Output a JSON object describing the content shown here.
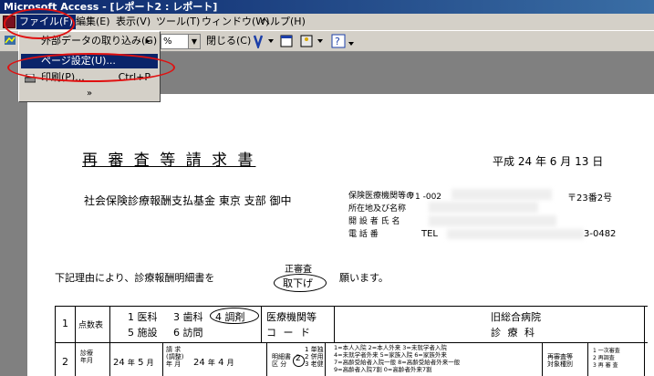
{
  "window": {
    "title": "Microsoft Access - [レポート2 : レポート]"
  },
  "menu": {
    "items": [
      {
        "label": "ファイル(F)"
      },
      {
        "label": "編集(E)"
      },
      {
        "label": "表示(V)"
      },
      {
        "label": "ツール(T)"
      },
      {
        "label": "ウィンドウ(W)"
      },
      {
        "label": "ヘルプ(H)"
      }
    ]
  },
  "toolbar": {
    "external_data": "外部データの取り込み(G)",
    "zoom": "%",
    "close": "閉じる(C)",
    "help": "?"
  },
  "dropdown": {
    "external_data": "外部データの取り込み(G)",
    "page_setup": "ページ設定(U)...",
    "print": "印刷(P)...",
    "print_shortcut": "Ctrl+P",
    "expand": "»"
  },
  "document": {
    "heading": "再 審 査 等 請 求 書",
    "date_era": "平成",
    "date_year": "24",
    "date_year_unit": "年",
    "date_month": "6",
    "date_month_unit": "月",
    "date_day": "13",
    "date_day_unit": "日",
    "addressee": "社会保険診療報酬支払基金 東京 支部 御中",
    "provider_label_1": "保険医療機関等の",
    "provider_label_2": "所在地及び名称",
    "founder_label": "開 設 者 氏 名",
    "phone_label": "電 話 番",
    "postal": "〒1",
    "postal_part": "-002",
    "address_tail": "〒23番2号",
    "tel": "TEL",
    "tel_tail": "3-0482",
    "request_prefix": "下記理由により、診療報酬明細書を",
    "request_option_top": "正審査",
    "request_option_selected": "取下げ",
    "request_suffix": "願います。",
    "table": {
      "row1_no": "1",
      "row1_label": "点数表",
      "opt1": "1 医科",
      "opt3": "3 歯科",
      "opt4": "4 調剤",
      "opt5": "5 施設",
      "opt6": "6 訪問",
      "inst_code_1": "医療機関等",
      "inst_code_2": "コ ー ド",
      "hospital_1": "旧総合病院",
      "hospital_2": "診 療 科",
      "row2_no": "2",
      "row2_label_1": "診療",
      "row2_label_2": "年月",
      "year_val": "24",
      "year_unit": "年",
      "month_val": "5",
      "month_unit": "月",
      "claim_1": "請 求",
      "claim_2": "(調整)",
      "claim_3": "年 月",
      "claim_year": "24",
      "claim_year_unit": "年",
      "claim_month": "4",
      "claim_month_unit": "月",
      "detail_1": "明細書",
      "detail_2": "区 分",
      "d_opt1": "1 単独",
      "d_opt2": "2 併用",
      "d_opt3": "3 老健",
      "sel_mark": "2",
      "types_1": "1=本人入院 2=本人外来 3=未就学者入院",
      "types_2": "4=未就学者外来 5=家族入院 6=家族外来",
      "types_3": "7=高齢受給者入院一般 8=高齢受給者外来一般",
      "types_4": "9=高齢者入院7割 0=高齢者外来7割",
      "reexam_1": "再審査等",
      "reexam_2": "対象種別",
      "right_1": "1 一次審査",
      "right_2": "2 再調査",
      "right_3": "3 再 審 査"
    }
  }
}
